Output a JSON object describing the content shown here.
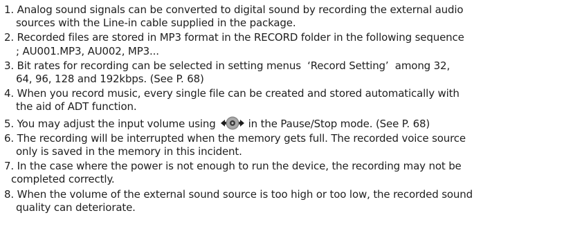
{
  "items": [
    {
      "number": "1.",
      "line1": "Analog sound signals can be converted to digital sound by recording the external audio",
      "line2": "sources with the Line-in cable supplied in the package."
    },
    {
      "number": "2.",
      "line1": "Recorded files are stored in MP3 format in the RECORD folder in the following sequence",
      "line2": "; AU001.MP3, AU002, MP3..."
    },
    {
      "number": "3.",
      "line1": "Bit rates for recording can be selected in setting menus  ‘Record Setting’  among 32,",
      "line2": "64, 96, 128 and 192kbps. (See P. 68)"
    },
    {
      "number": "4.",
      "line1": "When you record music, every single file can be created and stored automatically with",
      "line2": "the aid of ADT function."
    },
    {
      "number": "5.",
      "before_icon": "You may adjust the input volume using",
      "after_icon": "in the Pause/Stop mode. (See P. 68)",
      "icon": "navigation-dial-icon"
    },
    {
      "number": "6.",
      "line1": "The recording will be interrupted when the memory gets full. The recorded voice source",
      "line2": "only is saved in the memory in this incident."
    },
    {
      "number": "7.",
      "line1": "In the case where the power is not enough to run the device, the recording may not be",
      "line2": "completed correctly."
    },
    {
      "number": "8.",
      "line1": "When the volume of the external sound source is too high or too low, the recorded sound",
      "line2": "quality can deteriorate."
    }
  ],
  "colors": {
    "text": "#1e1e1e",
    "dial_body": "#8a8a8a",
    "dial_center": "#3d3d3d",
    "arrows": "#1e1e1e"
  }
}
